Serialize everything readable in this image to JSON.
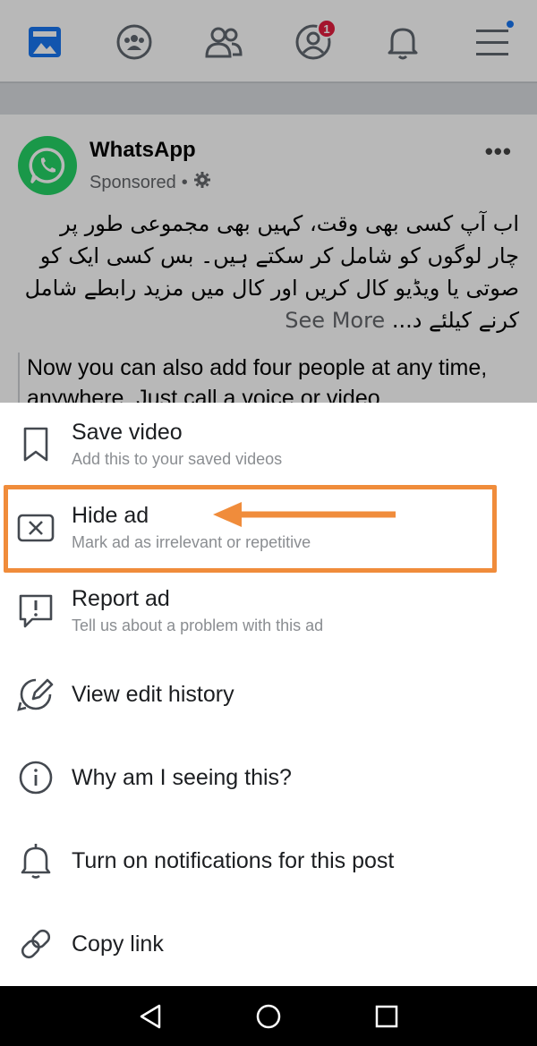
{
  "post": {
    "page_name": "WhatsApp",
    "sponsored": "Sponsored",
    "sponsored_sep": "•",
    "more_glyph": "•••",
    "urdu_text": "اب آپ کسی بھی وقت، کہیں بھی مجموعی طور پر چار لوگوں کو شامل کر سکتے ہیں۔ بس کسی ایک کو صوتی یا ویڈیو کال کریں اور کال میں مزید رابطے شامل کرنے کیلئے د...",
    "see_more": "See More",
    "english_text": "Now you can also add four people at any time, anywhere. Just call a voice or video"
  },
  "topnav": {
    "notification_badge": "1",
    "icons": [
      "news-feed-icon",
      "groups-icon",
      "friends-icon",
      "profile-icon",
      "bell-icon",
      "menu-icon"
    ]
  },
  "menu": {
    "items": [
      {
        "title": "Save video",
        "desc": "Add this to your saved videos",
        "icon": "bookmark-icon"
      },
      {
        "title": "Hide ad",
        "desc": "Mark ad as irrelevant or repetitive",
        "icon": "close-box-icon"
      },
      {
        "title": "Report ad",
        "desc": "Tell us about a problem with this ad",
        "icon": "report-icon"
      },
      {
        "title": "View edit history",
        "desc": "",
        "icon": "edit-history-icon"
      },
      {
        "title": "Why am I seeing this?",
        "desc": "",
        "icon": "info-icon"
      },
      {
        "title": "Turn on notifications for this post",
        "desc": "",
        "icon": "bell-icon"
      },
      {
        "title": "Copy link",
        "desc": "",
        "icon": "link-icon"
      }
    ]
  },
  "colors": {
    "highlight": "#f08c3b",
    "brand": "#1877f2",
    "whatsapp": "#25d366",
    "badge": "#e41e3f"
  },
  "system_nav": [
    "back-icon",
    "home-icon",
    "recents-icon"
  ]
}
